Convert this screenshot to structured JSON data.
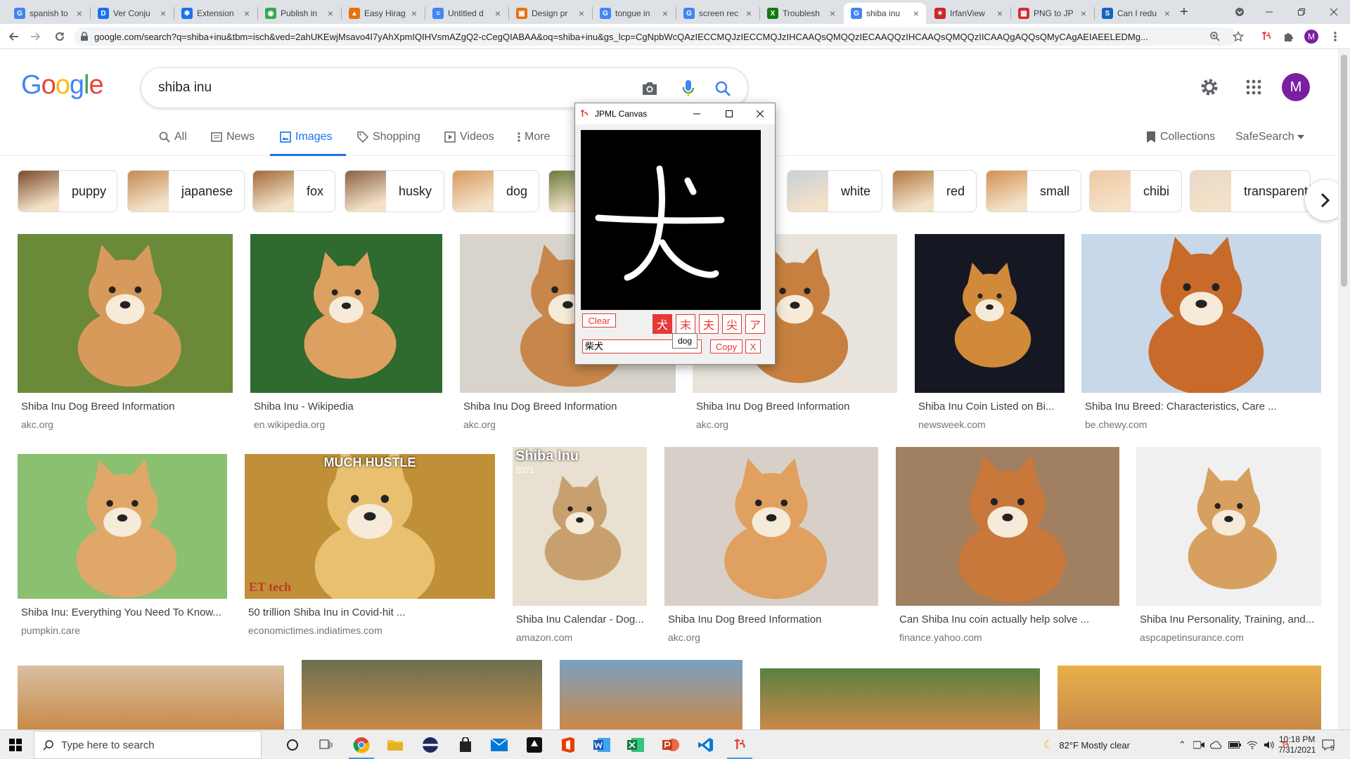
{
  "browser": {
    "tabs": [
      {
        "title": "spanish to",
        "icon": "google-icon",
        "color": "#4285f4",
        "glyph": "G"
      },
      {
        "title": "Ver Conju",
        "icon": "spanishdict-icon",
        "color": "#1a73e8",
        "glyph": "D"
      },
      {
        "title": "Extension",
        "icon": "puzzle-icon",
        "color": "#1a73e8",
        "glyph": "✱"
      },
      {
        "title": "Publish in",
        "icon": "chrome-store-icon",
        "color": "#34a853",
        "glyph": "◉"
      },
      {
        "title": "Easy Hirag",
        "icon": "site-icon",
        "color": "#e8710a",
        "glyph": "▲"
      },
      {
        "title": "Untitled d",
        "icon": "docs-icon",
        "color": "#4285f4",
        "glyph": "≡"
      },
      {
        "title": "Design pr",
        "icon": "pdf-icon",
        "color": "#e8710a",
        "glyph": "▣"
      },
      {
        "title": "tongue in",
        "icon": "google-icon",
        "color": "#4285f4",
        "glyph": "G"
      },
      {
        "title": "screen rec",
        "icon": "google-icon",
        "color": "#4285f4",
        "glyph": "G"
      },
      {
        "title": "Troublesh",
        "icon": "xbox-icon",
        "color": "#107c10",
        "glyph": "X"
      },
      {
        "title": "shiba inu",
        "icon": "google-icon",
        "color": "#4285f4",
        "glyph": "G",
        "active": true
      },
      {
        "title": "IrfanView",
        "icon": "irfanview-icon",
        "color": "#c62828",
        "glyph": "✶"
      },
      {
        "title": "PNG to JP",
        "icon": "converter-icon",
        "color": "#d32f2f",
        "glyph": "▦"
      },
      {
        "title": "Can I redu",
        "icon": "superuser-icon",
        "color": "#1565c0",
        "glyph": "S"
      }
    ],
    "new_tab": "+",
    "url": "google.com/search?q=shiba+inu&tbm=isch&ved=2ahUKEwjMsavo4I7yAhXpmIQIHVsmAZgQ2-cCegQIABAA&oq=shiba+inu&gs_lcp=CgNpbWcQAzIECCMQJzIECCMQJzIHCAAQsQMQQzIECAAQQzIHCAAQsQMQQzIICAAQgAQQsQMyCAgAEIAEELEDMg..."
  },
  "google": {
    "logo": "Google",
    "query": "shiba inu",
    "avatar_letter": "M",
    "tabs": [
      {
        "label": "All",
        "icon": "search-icon"
      },
      {
        "label": "News",
        "icon": "news-icon"
      },
      {
        "label": "Images",
        "icon": "image-icon",
        "active": true
      },
      {
        "label": "Shopping",
        "icon": "tag-icon"
      },
      {
        "label": "Videos",
        "icon": "play-icon"
      },
      {
        "label": "More",
        "icon": "dots-vertical-icon"
      }
    ],
    "collections": "Collections",
    "safesearch": "SafeSearch"
  },
  "chips": [
    "puppy",
    "japanese",
    "fox",
    "husky",
    "dog",
    "",
    "white",
    "red",
    "small",
    "chibi",
    "transparent"
  ],
  "results": [
    {
      "caption": "Shiba Inu Dog Breed Information",
      "source": "akc.org"
    },
    {
      "caption": "Shiba Inu - Wikipedia",
      "source": "en.wikipedia.org"
    },
    {
      "caption": "Shiba Inu Dog Breed Information",
      "source": "akc.org"
    },
    {
      "caption": "Shiba Inu Dog Breed Information",
      "source": "akc.org"
    },
    {
      "caption": "Shiba Inu Coin Listed on Bi...",
      "source": "newsweek.com"
    },
    {
      "caption": "Shiba Inu Breed: Characteristics, Care ...",
      "source": "be.chewy.com"
    },
    {
      "caption": "Shiba Inu: Everything You Need To Know...",
      "source": "pumpkin.care"
    },
    {
      "caption": "50 trillion Shiba Inu in Covid-hit ...",
      "source": "economictimes.indiatimes.com",
      "overlay_top": "MUCH HUSTLE",
      "overlay_bottom": "ET tech"
    },
    {
      "caption": "Shiba Inu Calendar - Dog...",
      "source": "amazon.com",
      "overlay_top": "Shiba Inu",
      "overlay_sub": "2021"
    },
    {
      "caption": "Shiba Inu Dog Breed Information",
      "source": "akc.org"
    },
    {
      "caption": "Can Shiba Inu coin actually help solve ...",
      "source": "finance.yahoo.com"
    },
    {
      "caption": "Shiba Inu Personality, Training, and...",
      "source": "aspcapetinsurance.com"
    }
  ],
  "popup": {
    "title": "JPML Canvas",
    "clear": "Clear",
    "candidates": [
      "犬",
      "末",
      "夫",
      "尖",
      "ア"
    ],
    "input_value": "柴犬",
    "copy": "Copy",
    "close_x": "X",
    "tooltip": "dog"
  },
  "taskbar": {
    "search_placeholder": "Type here to search",
    "weather": "82°F  Mostly clear",
    "time": "10:18 PM",
    "date": "7/31/2021",
    "notification_count": "5"
  },
  "colors": {
    "accent": "#1a73e8",
    "popup_red": "#e53935"
  }
}
